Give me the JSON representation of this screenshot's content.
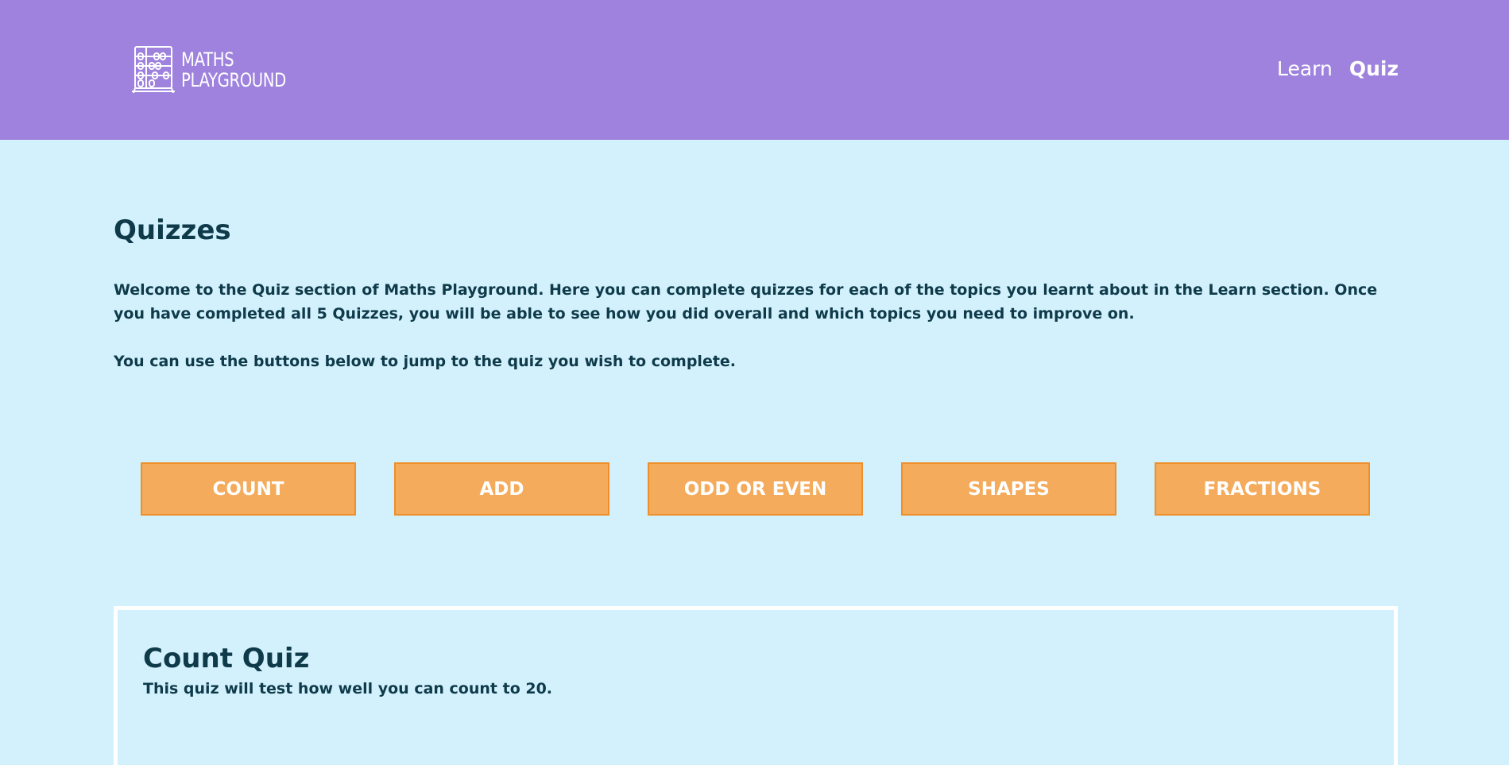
{
  "header": {
    "logo": {
      "line1": "MATHS",
      "line2": "PLAYGROUND",
      "icon": "abacus-icon"
    },
    "nav": [
      {
        "label": "Learn",
        "active": false
      },
      {
        "label": "Quiz",
        "active": true
      }
    ]
  },
  "main": {
    "title": "Quizzes",
    "intro": "Welcome to the Quiz section of Maths Playground. Here you can complete quizzes for each of the topics you learnt about in the Learn section. Once you have completed all 5 Quizzes, you will be able to see how you did overall and which topics you need to improve on.",
    "intro2": "You can use the buttons below to jump to the quiz you wish to complete.",
    "quiz_buttons": [
      {
        "label": "COUNT"
      },
      {
        "label": "ADD"
      },
      {
        "label": "ODD OR EVEN"
      },
      {
        "label": "SHAPES"
      },
      {
        "label": "FRACTIONS"
      }
    ]
  },
  "quiz_card": {
    "title": "Count Quiz",
    "description": "This quiz will test how well you can count to 20."
  },
  "colors": {
    "header_bg": "#9e82dd",
    "page_bg": "#d2f1fc",
    "button_bg": "#f4ab5c",
    "button_border": "#ef8f2a",
    "text": "#0e3a4a"
  }
}
